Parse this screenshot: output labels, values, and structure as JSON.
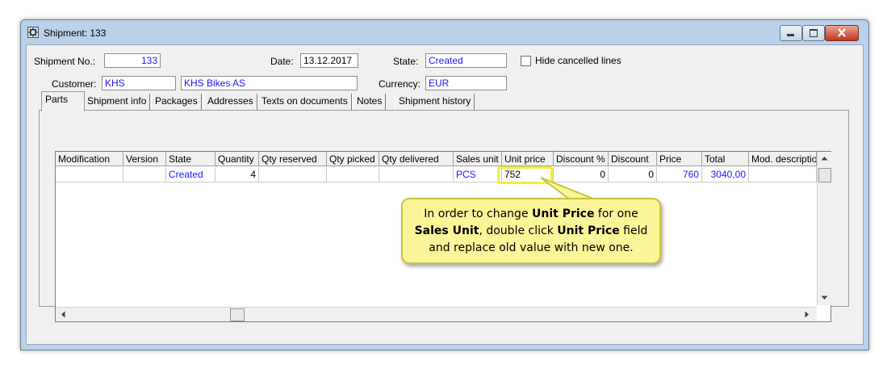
{
  "window": {
    "title": "Shipment: 133"
  },
  "header": {
    "shipment_no_label": "Shipment No.:",
    "shipment_no": "133",
    "date_label": "Date:",
    "date": "13.12.2017",
    "state_label": "State:",
    "state": "Created",
    "hide_cancelled_label": "Hide cancelled lines",
    "hide_cancelled_checked": false,
    "customer_label": "Customer:",
    "customer_code": "KHS",
    "customer_name": "KHS Bikes AS",
    "currency_label": "Currency:",
    "currency": "EUR"
  },
  "tabs": [
    "Parts",
    "Shipment info",
    "Packages",
    "Addresses",
    "Texts on documents",
    "Notes",
    "Shipment history"
  ],
  "grid": {
    "columns": [
      "Modification",
      "Version",
      "State",
      "Quantity",
      "Qty reserved",
      "Qty picked",
      "Qty delivered",
      "Sales unit",
      "Unit price",
      "Discount %",
      "Discount",
      "Price",
      "Total",
      "Mod. descriptio"
    ],
    "rows": [
      {
        "modification": "",
        "version": "",
        "state": "Created",
        "quantity": "4",
        "qty_reserved": "",
        "qty_picked": "",
        "qty_delivered": "",
        "sales_unit": "PCS",
        "unit_price": "752",
        "discount_pct": "0",
        "discount": "0",
        "price": "760",
        "total": "3040,00",
        "mod_description": ""
      }
    ]
  },
  "callout": {
    "t1": "In order to change ",
    "b1": "Unit Price",
    "t2": " for one ",
    "b2": "Sales Unit",
    "t3": ", double click ",
    "b3": "Unit Price",
    "t4": " field",
    "t5": "and replace old value with new one."
  },
  "colors": {
    "link_blue": "#1a1aff",
    "callout_bg": "#fbf599",
    "highlight": "#f2ed3f"
  }
}
